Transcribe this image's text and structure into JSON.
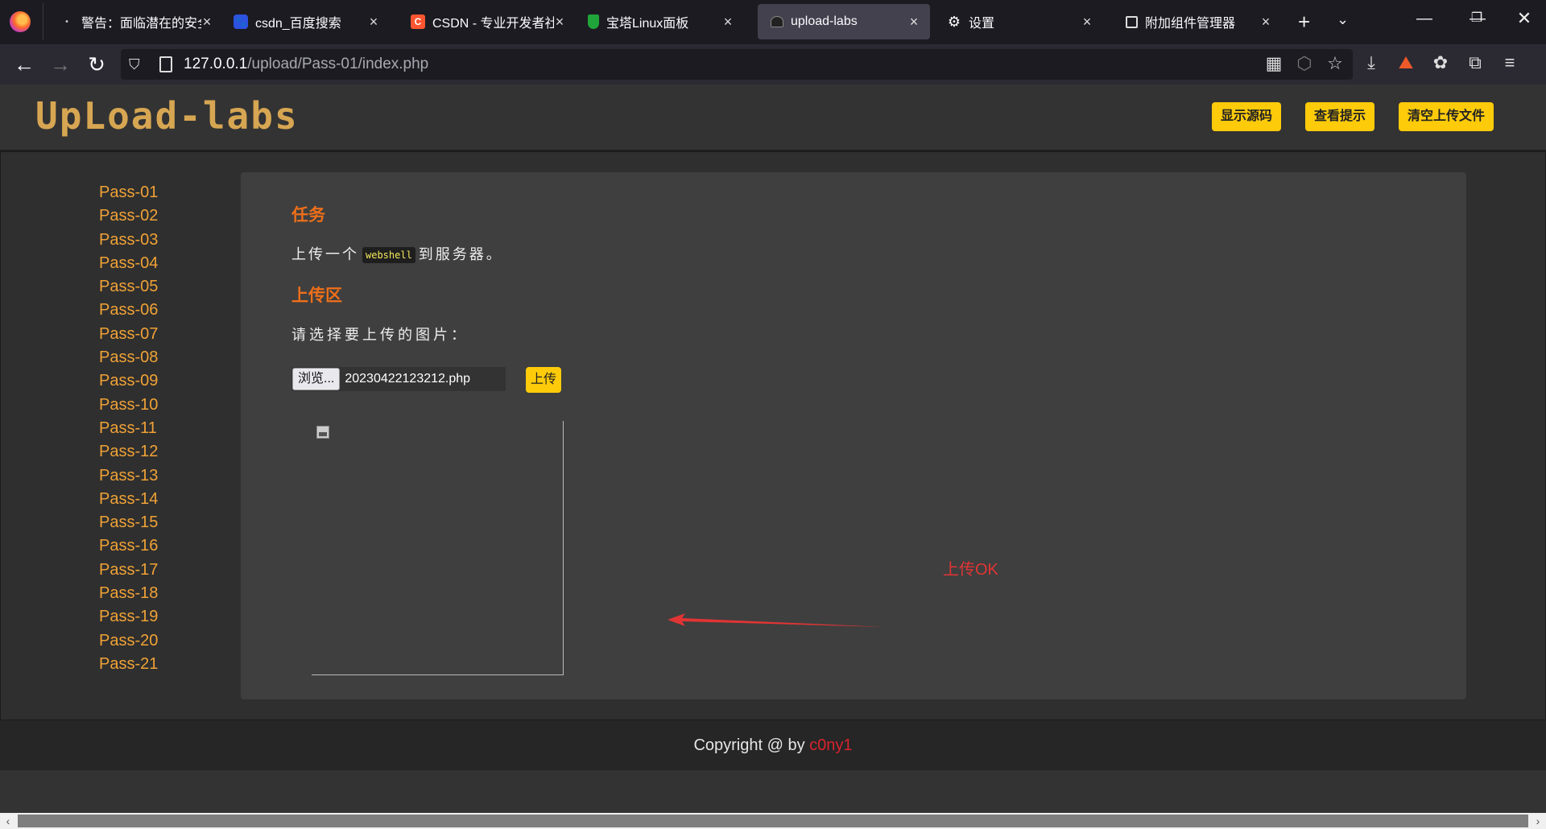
{
  "browser": {
    "tabs": [
      {
        "title": "警告：面临潜在的安全",
        "favicon": "warning-icon",
        "active": false
      },
      {
        "title": "csdn_百度搜索",
        "favicon": "baidu-icon",
        "active": false
      },
      {
        "title": "CSDN - 专业开发者社",
        "favicon": "csdn-icon",
        "favicon_text": "C",
        "active": false
      },
      {
        "title": "宝塔Linux面板",
        "favicon": "bt-icon",
        "active": false
      },
      {
        "title": "upload-labs",
        "favicon": "upload-labs-icon",
        "active": true
      },
      {
        "title": "设置",
        "favicon": "gear-icon",
        "active": false
      },
      {
        "title": "附加组件管理器",
        "favicon": "puzzle-icon",
        "active": false
      }
    ],
    "url_host": "127.0.0.1",
    "url_path": "/upload/Pass-01/index.php"
  },
  "site": {
    "logo": "UpLoad-labs",
    "buttons": {
      "show_source": "显示源码",
      "show_hint": "查看提示",
      "clear_uploads": "清空上传文件"
    },
    "passes": [
      "Pass-01",
      "Pass-02",
      "Pass-03",
      "Pass-04",
      "Pass-05",
      "Pass-06",
      "Pass-07",
      "Pass-08",
      "Pass-09",
      "Pass-10",
      "Pass-11",
      "Pass-12",
      "Pass-13",
      "Pass-14",
      "Pass-15",
      "Pass-16",
      "Pass-17",
      "Pass-18",
      "Pass-19",
      "Pass-20",
      "Pass-21"
    ]
  },
  "panel": {
    "task_heading": "任务",
    "task_prefix": "上传一个",
    "task_code": "webshell",
    "task_suffix": "到服务器。",
    "upload_heading": "上传区",
    "choose_label": "请选择要上传的图片：",
    "browse_label": "浏览...",
    "file_name": "20230422123212.php",
    "upload_button": "上传",
    "annotation": "上传OK"
  },
  "footer": {
    "copyright": "Copyright @  by ",
    "author": "c0ny1"
  },
  "colors": {
    "accent": "#fdcb0a",
    "link": "#f0a236",
    "heading": "#ee6f1a",
    "annotation": "#e23434"
  }
}
